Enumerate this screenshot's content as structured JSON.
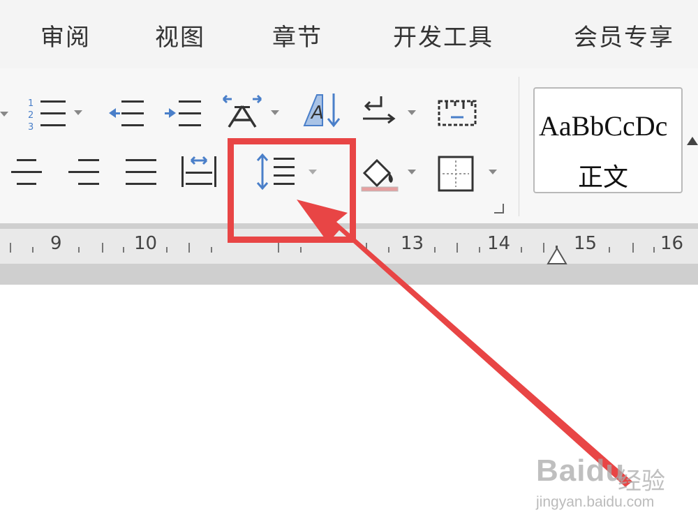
{
  "menu_tabs": [
    {
      "label": "审阅"
    },
    {
      "label": "视图"
    },
    {
      "label": "章节"
    },
    {
      "label": "开发工具"
    },
    {
      "label": "会员专享"
    }
  ],
  "styles": {
    "sample_text": "AaBbCcDc",
    "style_name": "正文"
  },
  "ruler": {
    "numbers": [
      "9",
      "10",
      "13",
      "14",
      "15",
      "16"
    ]
  },
  "icons": {
    "numbering": "numbered-list-icon",
    "decrease_indent": "decrease-indent-icon",
    "increase_indent": "increase-indent-icon",
    "char_spacing": "chinese-layout-icon",
    "sort": "sort-icon",
    "para_mark": "paragraph-mark-icon",
    "table_grid": "table-grid-icon",
    "align_center": "align-center-icon",
    "align_right": "align-right-icon",
    "justify": "justify-icon",
    "distributed": "distributed-align-icon",
    "line_spacing": "line-spacing-icon",
    "shading": "shading-icon",
    "borders": "borders-icon"
  },
  "colors": {
    "annotation_red": "#e84545",
    "icon_blue": "#4a7fc9",
    "icon_dark": "#333333"
  },
  "watermark": {
    "logo_text": "Baidu",
    "cn_text": "经验",
    "url_text": "jingyan.baidu.com"
  }
}
